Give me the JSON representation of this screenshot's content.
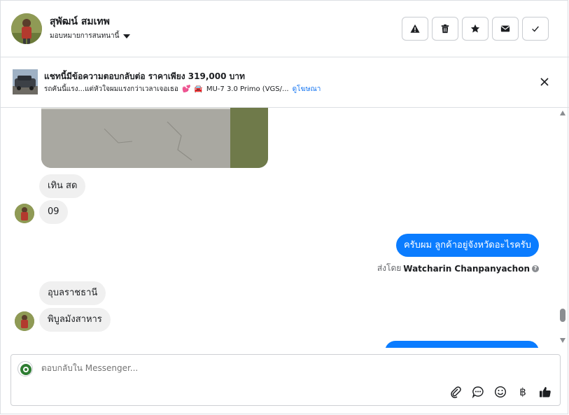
{
  "header": {
    "contact_name": "สุพัฒน์ สมเทพ",
    "assign_label": "มอบหมายการสนทนานี้",
    "actions": [
      {
        "icon": "warning-icon",
        "name": "mark-spam-button"
      },
      {
        "icon": "trash-icon",
        "name": "delete-button"
      },
      {
        "icon": "star-icon",
        "name": "star-button"
      },
      {
        "icon": "envelope-icon",
        "name": "mark-unread-button"
      },
      {
        "icon": "check-icon",
        "name": "mark-done-button"
      }
    ]
  },
  "ad": {
    "title": "แชทนี้มีข้อความตอบกลับต่อ ราคาเพียง 319,000 บาท",
    "text_part": "รถคันนี้แรง...แต่หัวใจผมแรงกว่าเวลาเจอเธอ",
    "heart_emoji": "💕",
    "car_emoji": "🚘",
    "model": "MU-7 3.0 Primo (VGS/...",
    "link": "ดูโฆษณา"
  },
  "messages": {
    "incoming": [
      {
        "text": "เทิน สด"
      },
      {
        "text": "09"
      },
      {
        "text": "อุบลราชธานี"
      },
      {
        "text": "พิบูลมังสาหาร"
      }
    ],
    "outgoing": [
      {
        "text": "ครับผม ลูกค้าอยู่จังหวัดอะไรครับ"
      }
    ],
    "sent_by_prefix": "ส่งโดย",
    "sent_by_name": "Watcharin Chanpanyachon",
    "info_mark": "?"
  },
  "composer": {
    "placeholder": "ตอบกลับใน Messenger...",
    "baht_symbol": "฿"
  },
  "colors": {
    "outgoing_bubble": "#0a7cff",
    "incoming_bubble": "#f0f0f0",
    "link": "#1877f2"
  }
}
